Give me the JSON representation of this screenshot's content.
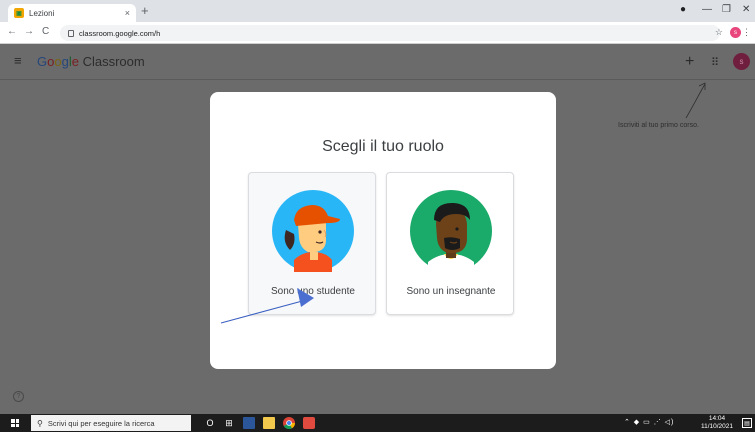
{
  "browser": {
    "tab_title": "Lezioni",
    "tab_close": "×",
    "new_tab": "+",
    "url": "classroom.google.com/h",
    "back": "←",
    "forward": "→",
    "reload": "C",
    "star": "☆",
    "profile_initial": "s",
    "menu": "⋮",
    "minimize": "—",
    "maximize": "❐",
    "close": "✕",
    "record": "●"
  },
  "appbar": {
    "brand_google": [
      "G",
      "o",
      "o",
      "g",
      "l",
      "e"
    ],
    "brand_product": "Classroom",
    "plus": "+",
    "apps": "⠿",
    "avatar_initial": "s",
    "menu": "≡"
  },
  "background": {
    "hint": "Iscriviti al tuo primo corso.",
    "help": "?"
  },
  "dialog": {
    "title": "Scegli il tuo ruolo",
    "student_label": "Sono uno studente",
    "teacher_label": "Sono un insegnante"
  },
  "taskbar": {
    "search_placeholder": "Scrivi qui per eseguire la ricerca",
    "search_icon": "⚲",
    "time": "14:04",
    "date": "11/10/2021",
    "tray": "⌃ ◆ ▭ ⋰ ◁)",
    "notification": "▤",
    "cortana": "O",
    "task_view": "⊞"
  },
  "colors": {
    "student_circle": "#29b6f6",
    "teacher_circle": "#1aaa6a",
    "annotation_arrow": "#3a5fc0"
  }
}
